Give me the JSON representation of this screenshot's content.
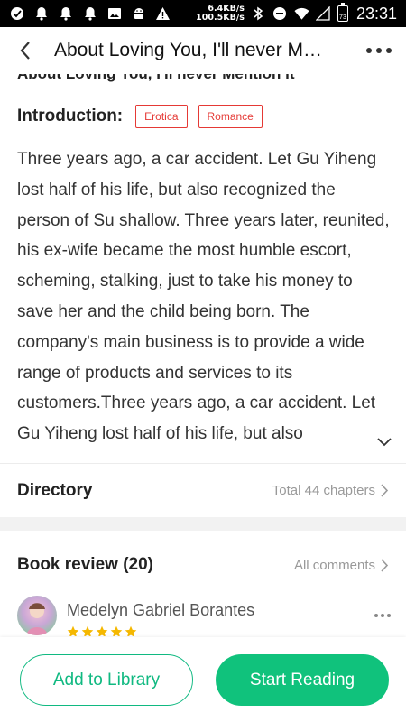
{
  "status_bar": {
    "net_speed_up": "6.4KB/s",
    "net_speed_down": "100.5KB/s",
    "battery": "73",
    "time": "23:31"
  },
  "header": {
    "title": "About Loving You, I'll never Mention it",
    "clipped_title": "About Loving You, I'll never Mention it"
  },
  "introduction": {
    "label": "Introduction:",
    "tags": [
      "Erotica",
      "Romance"
    ],
    "text": "Three years ago, a car accident. Let Gu Yiheng lost half of his life, but also recognized the person of Su shallow. Three years later, reunited, his ex-wife became the most humble escort, scheming, stalking, just to take his money to save her and the child being born. The company's main business is to provide a wide range of products and services to its customers.Three years ago, a car accident. Let Gu Yiheng lost half of his life, but also"
  },
  "directory": {
    "label": "Directory",
    "total": "Total 44 chapters"
  },
  "reviews": {
    "label": "Book review (20)",
    "all_link": "All comments",
    "items": [
      {
        "name": "Medelyn Gabriel Borantes",
        "rating": 5
      }
    ]
  },
  "actions": {
    "add_library": "Add to Library",
    "start_reading": "Start Reading"
  },
  "colors": {
    "accent_green": "#10c27c",
    "tag_red": "#e53935",
    "star_yellow": "#f5b800"
  }
}
